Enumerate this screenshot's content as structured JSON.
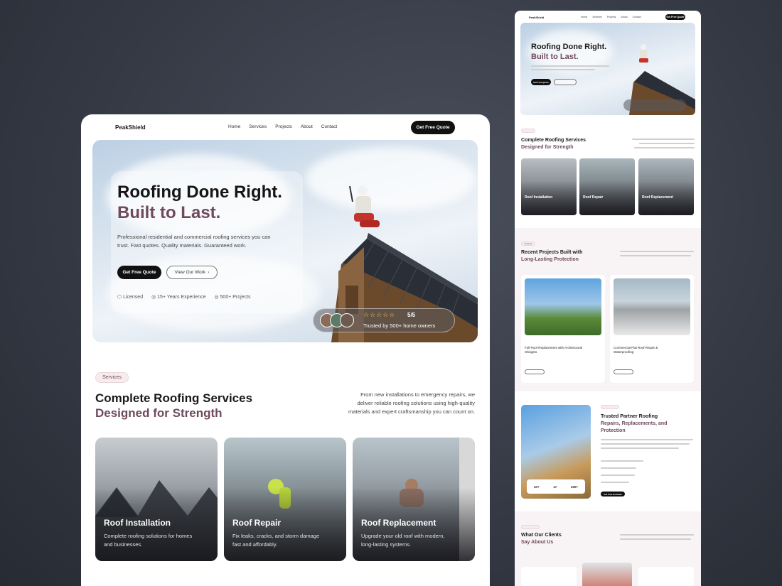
{
  "brand": "PeakShield",
  "nav": [
    "Home",
    "Services",
    "Projects",
    "About",
    "Contact"
  ],
  "cta": "Get Free Quote",
  "hero": {
    "title1": "Roofing Done Right.",
    "title2": "Built to Last.",
    "desc1": "Professional residential and commercial roofing services you can",
    "desc2": "trust. Fast quotes. Quality materials. Guaranteed work.",
    "btn1": "Get Free Quote",
    "btn2": "View Our Work",
    "feats": [
      "Licensed",
      "15+ Years Experience",
      "500+ Projects"
    ],
    "rating": "5/5",
    "trusted": "Trusted by 500+ home owners"
  },
  "services": {
    "pill": "Services",
    "h1": "Complete Roofing Services",
    "h2": "Designed for Strength",
    "intro1": "From new installations to emergency repairs, we",
    "intro2": "deliver reliable roofing solutions using high-quality",
    "intro3": "materials and expert craftsmanship you can count on.",
    "cards": [
      {
        "title": "Roof Installation",
        "d1": "Complete roofing solutions for homes",
        "d2": "and businesses."
      },
      {
        "title": "Roof Repair",
        "d1": "Fix leaks, cracks, and storm damage",
        "d2": "fast and affordably."
      },
      {
        "title": "Roof Replacement",
        "d1": "Upgrade your old roof with modern,",
        "d2": "long-lasting systems."
      }
    ]
  },
  "mobile": {
    "cta": "Get Free Quote",
    "heroBtn": "Get Free Quote",
    "projects": {
      "pill": "Projects",
      "h1": "Recent Projects Built with",
      "h2": "Long-Lasting Protection",
      "cards": [
        {
          "title1": "Full Roof Replacement with Architectural",
          "title2": "Shingles"
        },
        {
          "title1": "Commercial Flat Roof Repair &",
          "title2": "Waterproofing"
        }
      ]
    },
    "about": {
      "h1": "Trusted Partner Roofing",
      "h2": "Repairs, Replacements, and",
      "h3": "Protection",
      "stats": [
        "10+",
        "17",
        "200+"
      ],
      "btn": "Get Free Estimate"
    },
    "testimonials": {
      "h1": "What Our Clients",
      "h2": "Say About Us"
    }
  }
}
